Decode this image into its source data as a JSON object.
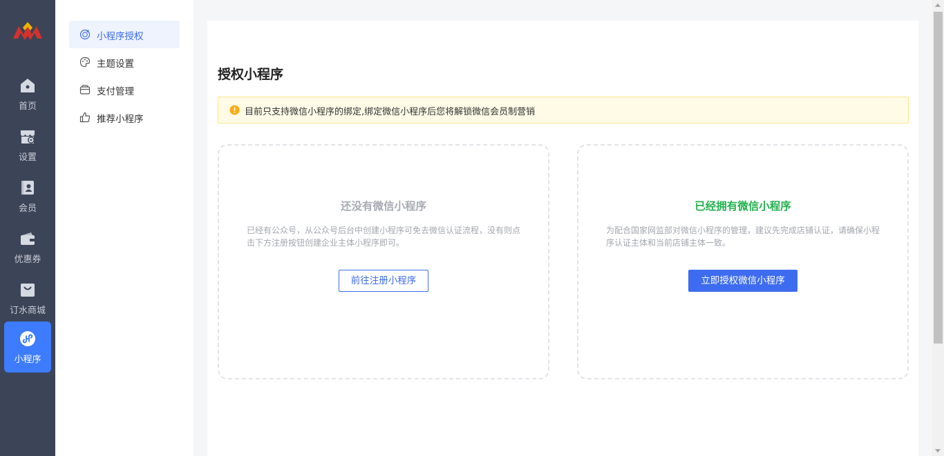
{
  "rail": {
    "items": [
      {
        "label": "首页",
        "icon": "home-icon"
      },
      {
        "label": "设置",
        "icon": "store-settings-icon"
      },
      {
        "label": "会员",
        "icon": "member-card-icon"
      },
      {
        "label": "优惠券",
        "icon": "wallet-icon"
      },
      {
        "label": "订水商城",
        "icon": "shopping-bag-icon"
      },
      {
        "label": "小程序",
        "icon": "mini-program-icon",
        "active": true
      }
    ]
  },
  "submenu": {
    "items": [
      {
        "label": "小程序授权",
        "icon": "authorize-icon",
        "active": true
      },
      {
        "label": "主题设置",
        "icon": "palette-icon"
      },
      {
        "label": "支付管理",
        "icon": "payment-icon"
      },
      {
        "label": "推荐小程序",
        "icon": "thumbs-up-icon"
      }
    ]
  },
  "main": {
    "title": "授权小程序",
    "notice": "目前只支持微信小程序的绑定,绑定微信小程序后您将解锁微信会员制营销",
    "cards": [
      {
        "title": "还没有微信小程序",
        "desc": "已经有公众号，从公众号后台中创建小程序可免去微信认证流程，没有则点击下方注册按钮创建企业主体小程序即可。",
        "button": "前往注册小程序"
      },
      {
        "title": "已经拥有微信小程序",
        "desc": "为配合国家网监部对微信小程序的管理，建议先完成店铺认证，请确保小程序认证主体和当前店铺主体一致。",
        "button": "立即授权微信小程序"
      }
    ]
  },
  "colors": {
    "rail_bg": "#3c4457",
    "accent": "#3d6cf0",
    "success": "#21b24d",
    "warning": "#faad14"
  }
}
